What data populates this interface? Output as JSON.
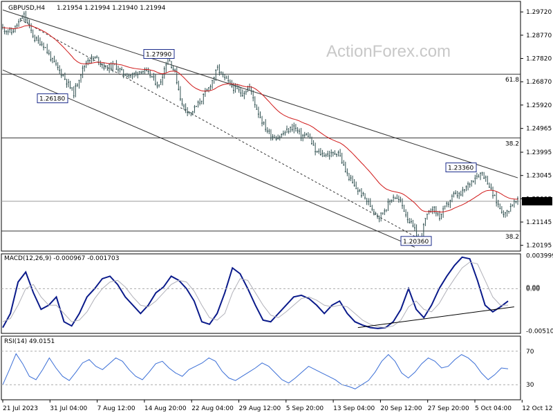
{
  "header": {
    "symbol": "GBPUSD,H4",
    "ohlc": "1.21954 1.21994 1.21940 1.21994"
  },
  "watermark": "ActionForex.com",
  "colors": {
    "candle": "#2f4f4f",
    "ema": "#d01818",
    "macd": "#0a1a8a",
    "signal": "#b0b0b8",
    "rsi": "#3a6ed6",
    "channel": "#333333",
    "level": "#333333"
  },
  "chart_data": [
    {
      "type": "candlestick",
      "title": "GBPUSD,H4",
      "y_ticks": [
        "1.29720",
        "1.28770",
        "1.27820",
        "1.26870",
        "1.25920",
        "1.24965",
        "1.23995",
        "1.23045",
        "1.22095",
        "1.21145",
        "1.20195"
      ],
      "ylim": [
        1.1996,
        1.3015
      ],
      "x_ticks": [
        "21 Jul 2023",
        "31 Jul 04:00",
        "7 Aug 12:00",
        "14 Aug 20:00",
        "22 Aug 04:00",
        "29 Aug 12:00",
        "5 Sep 20:00",
        "13 Sep 04:00",
        "20 Sep 12:00",
        "27 Sep 20:00",
        "5 Oct 04:00",
        "12 Oct 12:00"
      ],
      "current_price": "1.21994",
      "annotations": [
        {
          "text": "1.27990",
          "value": 1.2799
        },
        {
          "text": "1.26180",
          "value": 1.2618
        },
        {
          "text": "1.23360",
          "value": 1.2336
        },
        {
          "text": "1.20360",
          "value": 1.2036
        }
      ],
      "fib_levels": [
        {
          "label": "61.8",
          "value": 1.2718
        },
        {
          "label": "38.2",
          "value": 1.2458
        },
        {
          "label": "38.2",
          "value": 1.2078
        }
      ],
      "horizontal_line": 1.21994,
      "moving_average": "red",
      "close_path": [
        [
          0,
          1.2905
        ],
        [
          5,
          1.2888
        ],
        [
          12,
          1.2958
        ],
        [
          18,
          1.2862
        ],
        [
          23,
          1.2838
        ],
        [
          28,
          1.2772
        ],
        [
          34,
          1.2712
        ],
        [
          40,
          1.264
        ],
        [
          44,
          1.2722
        ],
        [
          48,
          1.278
        ],
        [
          53,
          1.2782
        ],
        [
          58,
          1.2742
        ],
        [
          63,
          1.2755
        ],
        [
          68,
          1.272
        ],
        [
          73,
          1.2712
        ],
        [
          78,
          1.2735
        ],
        [
          83,
          1.2715
        ],
        [
          88,
          1.2668
        ],
        [
          93,
          1.2788
        ],
        [
          97,
          1.2725
        ],
        [
          101,
          1.2592
        ],
        [
          106,
          1.2558
        ],
        [
          111,
          1.2605
        ],
        [
          116,
          1.266
        ],
        [
          121,
          1.274
        ],
        [
          125,
          1.27
        ],
        [
          130,
          1.2662
        ],
        [
          135,
          1.264
        ],
        [
          139,
          1.2665
        ],
        [
          143,
          1.2578
        ],
        [
          147,
          1.251
        ],
        [
          151,
          1.2468
        ],
        [
          155,
          1.246
        ],
        [
          160,
          1.2485
        ],
        [
          164,
          1.2505
        ],
        [
          168,
          1.2465
        ],
        [
          172,
          1.247
        ],
        [
          176,
          1.2402
        ],
        [
          180,
          1.2392
        ],
        [
          185,
          1.239
        ],
        [
          189,
          1.2402
        ],
        [
          193,
          1.2322
        ],
        [
          198,
          1.226
        ],
        [
          203,
          1.2222
        ],
        [
          208,
          1.2172
        ],
        [
          212,
          1.2135
        ],
        [
          216,
          1.2175
        ],
        [
          220,
          1.222
        ],
        [
          224,
          1.2198
        ],
        [
          228,
          1.2132
        ],
        [
          232,
          1.208
        ],
        [
          235,
          1.2036
        ],
        [
          238,
          1.2125
        ],
        [
          242,
          1.2175
        ],
        [
          246,
          1.2135
        ],
        [
          250,
          1.2182
        ],
        [
          254,
          1.2225
        ],
        [
          258,
          1.2225
        ],
        [
          262,
          1.2265
        ],
        [
          266,
          1.23
        ],
        [
          270,
          1.2316
        ],
        [
          273,
          1.228
        ],
        [
          276,
          1.2226
        ],
        [
          280,
          1.2172
        ],
        [
          283,
          1.2145
        ],
        [
          287,
          1.219
        ],
        [
          290,
          1.2199
        ]
      ]
    },
    {
      "type": "line",
      "title": "MACD(12,26,9) -0.000967 -0.001703",
      "y_ticks": [
        "0.003999",
        "0.00",
        "0.00",
        "-0.005103"
      ],
      "ylim": [
        -0.0054,
        0.0042
      ],
      "series": [
        {
          "name": "MACD",
          "values": [
            -0.0047,
            -0.003,
            0.0008,
            0.002,
            -0.0005,
            -0.0025,
            -0.002,
            -0.001,
            -0.004,
            -0.0045,
            -0.003,
            -0.001,
            0.0,
            0.0012,
            0.0015,
            0.0005,
            -0.001,
            -0.002,
            -0.003,
            -0.002,
            -0.0005,
            0.0002,
            0.0015,
            0.001,
            0.0,
            -0.0015,
            -0.004,
            -0.0043,
            -0.003,
            -0.0005,
            0.0025,
            0.0018,
            0.0,
            -0.002,
            -0.0038,
            -0.004,
            -0.003,
            -0.002,
            -0.001,
            -0.0008,
            -0.0012,
            -0.002,
            -0.003,
            -0.002,
            -0.0015,
            -0.003,
            -0.004,
            -0.0044,
            -0.0047,
            -0.0048,
            -0.0047,
            -0.004,
            -0.0025,
            0.0,
            -0.0025,
            -0.0035,
            -0.002,
            0.0,
            0.0015,
            0.0028,
            0.0038,
            0.0036,
            0.001,
            -0.002,
            -0.0028,
            -0.0022,
            -0.0015
          ]
        },
        {
          "name": "Signal",
          "values": [
            -0.004,
            -0.0036,
            -0.002,
            0.0,
            0.0005,
            -0.001,
            -0.002,
            -0.002,
            -0.003,
            -0.004,
            -0.0038,
            -0.0028,
            -0.0012,
            0.0,
            0.0008,
            0.001,
            0.0002,
            -0.001,
            -0.002,
            -0.0022,
            -0.0015,
            -0.0005,
            0.0005,
            0.001,
            0.0008,
            -0.0003,
            -0.002,
            -0.0035,
            -0.0038,
            -0.003,
            -0.0005,
            0.0012,
            0.001,
            -0.0005,
            -0.002,
            -0.0032,
            -0.0035,
            -0.0028,
            -0.002,
            -0.0012,
            -0.001,
            -0.0014,
            -0.002,
            -0.0022,
            -0.002,
            -0.0022,
            -0.003,
            -0.0038,
            -0.0043,
            -0.0046,
            -0.0047,
            -0.0045,
            -0.0038,
            -0.0022,
            -0.0015,
            -0.0025,
            -0.0028,
            -0.0018,
            -0.0002,
            0.0012,
            0.0025,
            0.0032,
            0.003,
            0.001,
            -0.001,
            -0.002,
            -0.002
          ]
        }
      ],
      "zero_line": 0
    },
    {
      "type": "line",
      "title": "RSI(14) 49.0151",
      "y_ticks": [
        "70",
        "30"
      ],
      "ylim": [
        12,
        88
      ],
      "series": [
        {
          "name": "RSI",
          "values": [
            30,
            48,
            67,
            55,
            40,
            36,
            48,
            62,
            50,
            40,
            35,
            45,
            56,
            60,
            52,
            48,
            55,
            62,
            58,
            48,
            40,
            36,
            45,
            55,
            58,
            50,
            44,
            40,
            48,
            52,
            56,
            62,
            58,
            46,
            38,
            35,
            40,
            45,
            50,
            56,
            52,
            44,
            36,
            32,
            38,
            45,
            52,
            48,
            44,
            40,
            36,
            30,
            28,
            25,
            30,
            35,
            45,
            58,
            66,
            58,
            44,
            38,
            45,
            55,
            62,
            58,
            50,
            52,
            60,
            66,
            62,
            55,
            44,
            36,
            42,
            50,
            49
          ]
        }
      ],
      "levels": [
        70,
        30
      ]
    }
  ]
}
